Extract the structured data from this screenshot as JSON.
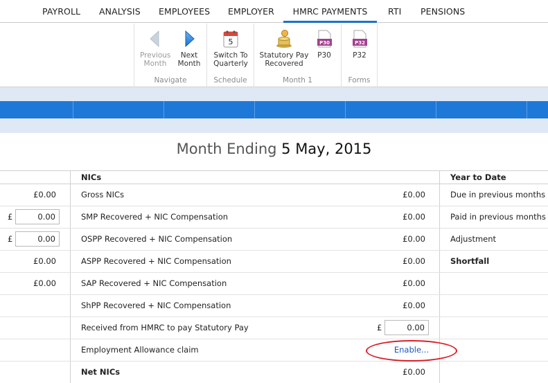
{
  "tabs": [
    "PAYROLL",
    "ANALYSIS",
    "EMPLOYEES",
    "EMPLOYER",
    "HMRC PAYMENTS",
    "RTI",
    "PENSIONS"
  ],
  "active_tab": "HMRC PAYMENTS",
  "ribbon": {
    "navigate": {
      "label": "Navigate",
      "previous_line1": "Previous",
      "previous_line2": "Month",
      "next_line1": "Next",
      "next_line2": "Month"
    },
    "schedule": {
      "label": "Schedule",
      "switch_line1": "Switch To",
      "switch_line2": "Quarterly",
      "calendar_number": "5"
    },
    "month": {
      "label": "Month 1",
      "statpay_line1": "Statutory Pay",
      "statpay_line2": "Recovered",
      "p30": "P30",
      "p30_icon": "P30"
    },
    "forms": {
      "label": "Forms",
      "p32": "P32",
      "p32_icon": "P32"
    }
  },
  "title": {
    "prefix": "Month Ending",
    "date": "5 May, 2015"
  },
  "left_col": {
    "rows": [
      {
        "type": "value",
        "value": "£0.00"
      },
      {
        "type": "input",
        "currency": "£",
        "value": "0.00"
      },
      {
        "type": "input",
        "currency": "£",
        "value": "0.00"
      },
      {
        "type": "value",
        "value": "£0.00"
      },
      {
        "type": "value",
        "value": "£0.00"
      }
    ]
  },
  "nics": {
    "header": "NICs",
    "rows": [
      {
        "label": "Gross NICs",
        "value": "£0.00"
      },
      {
        "label": "SMP Recovered + NIC Compensation",
        "value": "£0.00"
      },
      {
        "label": "OSPP Recovered + NIC Compensation",
        "value": "£0.00"
      },
      {
        "label": "ASPP Recovered + NIC Compensation",
        "value": "£0.00"
      },
      {
        "label": "SAP Recovered + NIC Compensation",
        "value": "£0.00"
      },
      {
        "label": "ShPP Recovered + NIC Compensation",
        "value": "£0.00"
      },
      {
        "label": "Received from HMRC to pay Statutory Pay",
        "currency": "£",
        "input_value": "0.00"
      },
      {
        "label": "Employment Allowance claim",
        "link": "Enable..."
      },
      {
        "label": "Net NICs",
        "value": "£0.00"
      }
    ]
  },
  "ytd": {
    "header": "Year to Date",
    "rows": [
      "Due in previous months",
      "Paid in previous months",
      "Adjustment",
      "Shortfall"
    ]
  }
}
